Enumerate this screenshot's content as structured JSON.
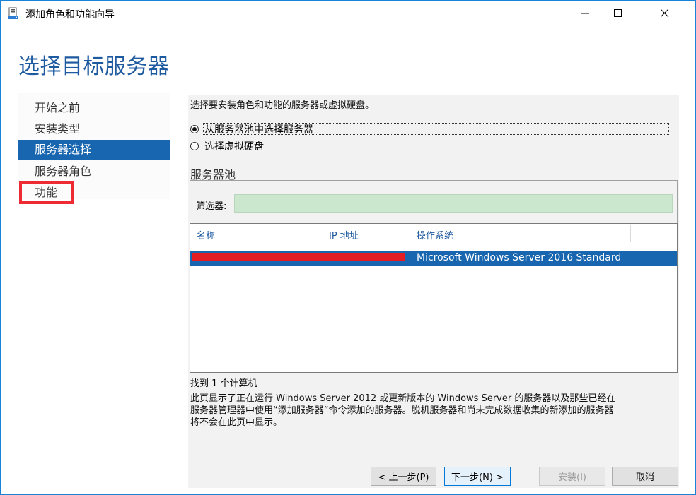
{
  "window": {
    "title": "添加角色和功能向导",
    "controls": {
      "minimize": "—",
      "maximize": "☐",
      "close": "✕"
    }
  },
  "page": {
    "title": "选择目标服务器"
  },
  "nav": {
    "items": [
      {
        "label": "开始之前",
        "state": "normal"
      },
      {
        "label": "安装类型",
        "state": "normal"
      },
      {
        "label": "服务器选择",
        "state": "active"
      },
      {
        "label": "服务器角色",
        "state": "normal"
      },
      {
        "label": "功能",
        "state": "disabled"
      }
    ]
  },
  "content": {
    "intro": "选择要安装角色和功能的服务器或虚拟硬盘。",
    "options": [
      {
        "label": "从服务器池中选择服务器",
        "checked": true
      },
      {
        "label": "选择虚拟硬盘",
        "checked": false
      }
    ],
    "pool_title": "服务器池",
    "filter_label": "筛选器:",
    "filter_value": "",
    "columns": [
      "名称",
      "IP 地址",
      "操作系统"
    ],
    "rows": [
      {
        "name": "",
        "ip": "",
        "os": "Microsoft Windows Server 2016 Standard",
        "selected": true
      }
    ],
    "found": "找到 1 个计算机",
    "note_lines": [
      "此页显示了正在运行 Windows Server 2012 或更新版本的 Windows Server 的服务器以及那些已经在",
      "服务器管理器中使用“添加服务器”命令添加的服务器。脱机服务器和尚未完成数据收集的新添加的服务器",
      "将不会在此页中显示。"
    ]
  },
  "buttons": {
    "prev": "< 上一步(P)",
    "next": "下一步(N) >",
    "install": "安装(I)",
    "cancel": "取消"
  },
  "colors": {
    "accent": "#1866b0",
    "title": "#1e5aa0",
    "filter_bg": "#cbe8cf",
    "highlight_box": "#ee2a33"
  }
}
